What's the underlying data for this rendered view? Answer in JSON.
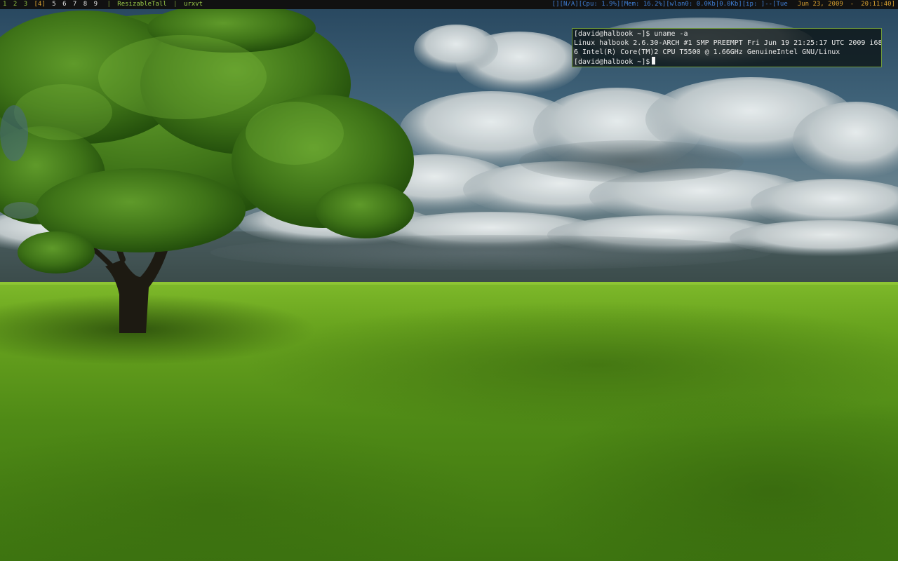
{
  "topbar": {
    "workspaces": [
      {
        "label": "1",
        "state": "normal"
      },
      {
        "label": "2",
        "state": "normal"
      },
      {
        "label": "3",
        "state": "normal"
      },
      {
        "label": "[4]",
        "state": "current"
      },
      {
        "label": "5",
        "state": "occupied"
      },
      {
        "label": "6",
        "state": "occupied"
      },
      {
        "label": "7",
        "state": "occupied"
      },
      {
        "label": "8",
        "state": "occupied"
      },
      {
        "label": "9",
        "state": "occupied"
      }
    ],
    "separator": "|",
    "layout": "ResizableTall",
    "window_title": "urxvt",
    "status": {
      "empty_bracket": "[]",
      "battery": "[N/A]",
      "cpu": "[Cpu: 1.9%]",
      "mem": "[Mem: 16.2%]",
      "wlan": "[wlan0: 0.0Kb|0.0Kb]",
      "ip": "[ip: ]",
      "dash": "--",
      "date_open": "[Tue",
      "date": "Jun 23, 2009",
      "date_dash": "-",
      "time": "20:11:40]"
    }
  },
  "terminal": {
    "lines": [
      "[david@halbook ~]$ uname -a",
      "Linux halbook 2.6.30-ARCH #1 SMP PREEMPT Fri Jun 19 21:25:17 UTC 2009 i68",
      "6 Intel(R) Core(TM)2 CPU T5500 @ 1.66GHz GenuineIntel GNU/Linux"
    ],
    "prompt": "[david@halbook ~]$"
  },
  "colors": {
    "bar_background": "#111111",
    "bar_green": "#9ccc4a",
    "bar_blue": "#3f7fd6",
    "bar_orange": "#d8a030",
    "terminal_border": "#6f9a3a",
    "terminal_text": "#e8e8e8"
  }
}
